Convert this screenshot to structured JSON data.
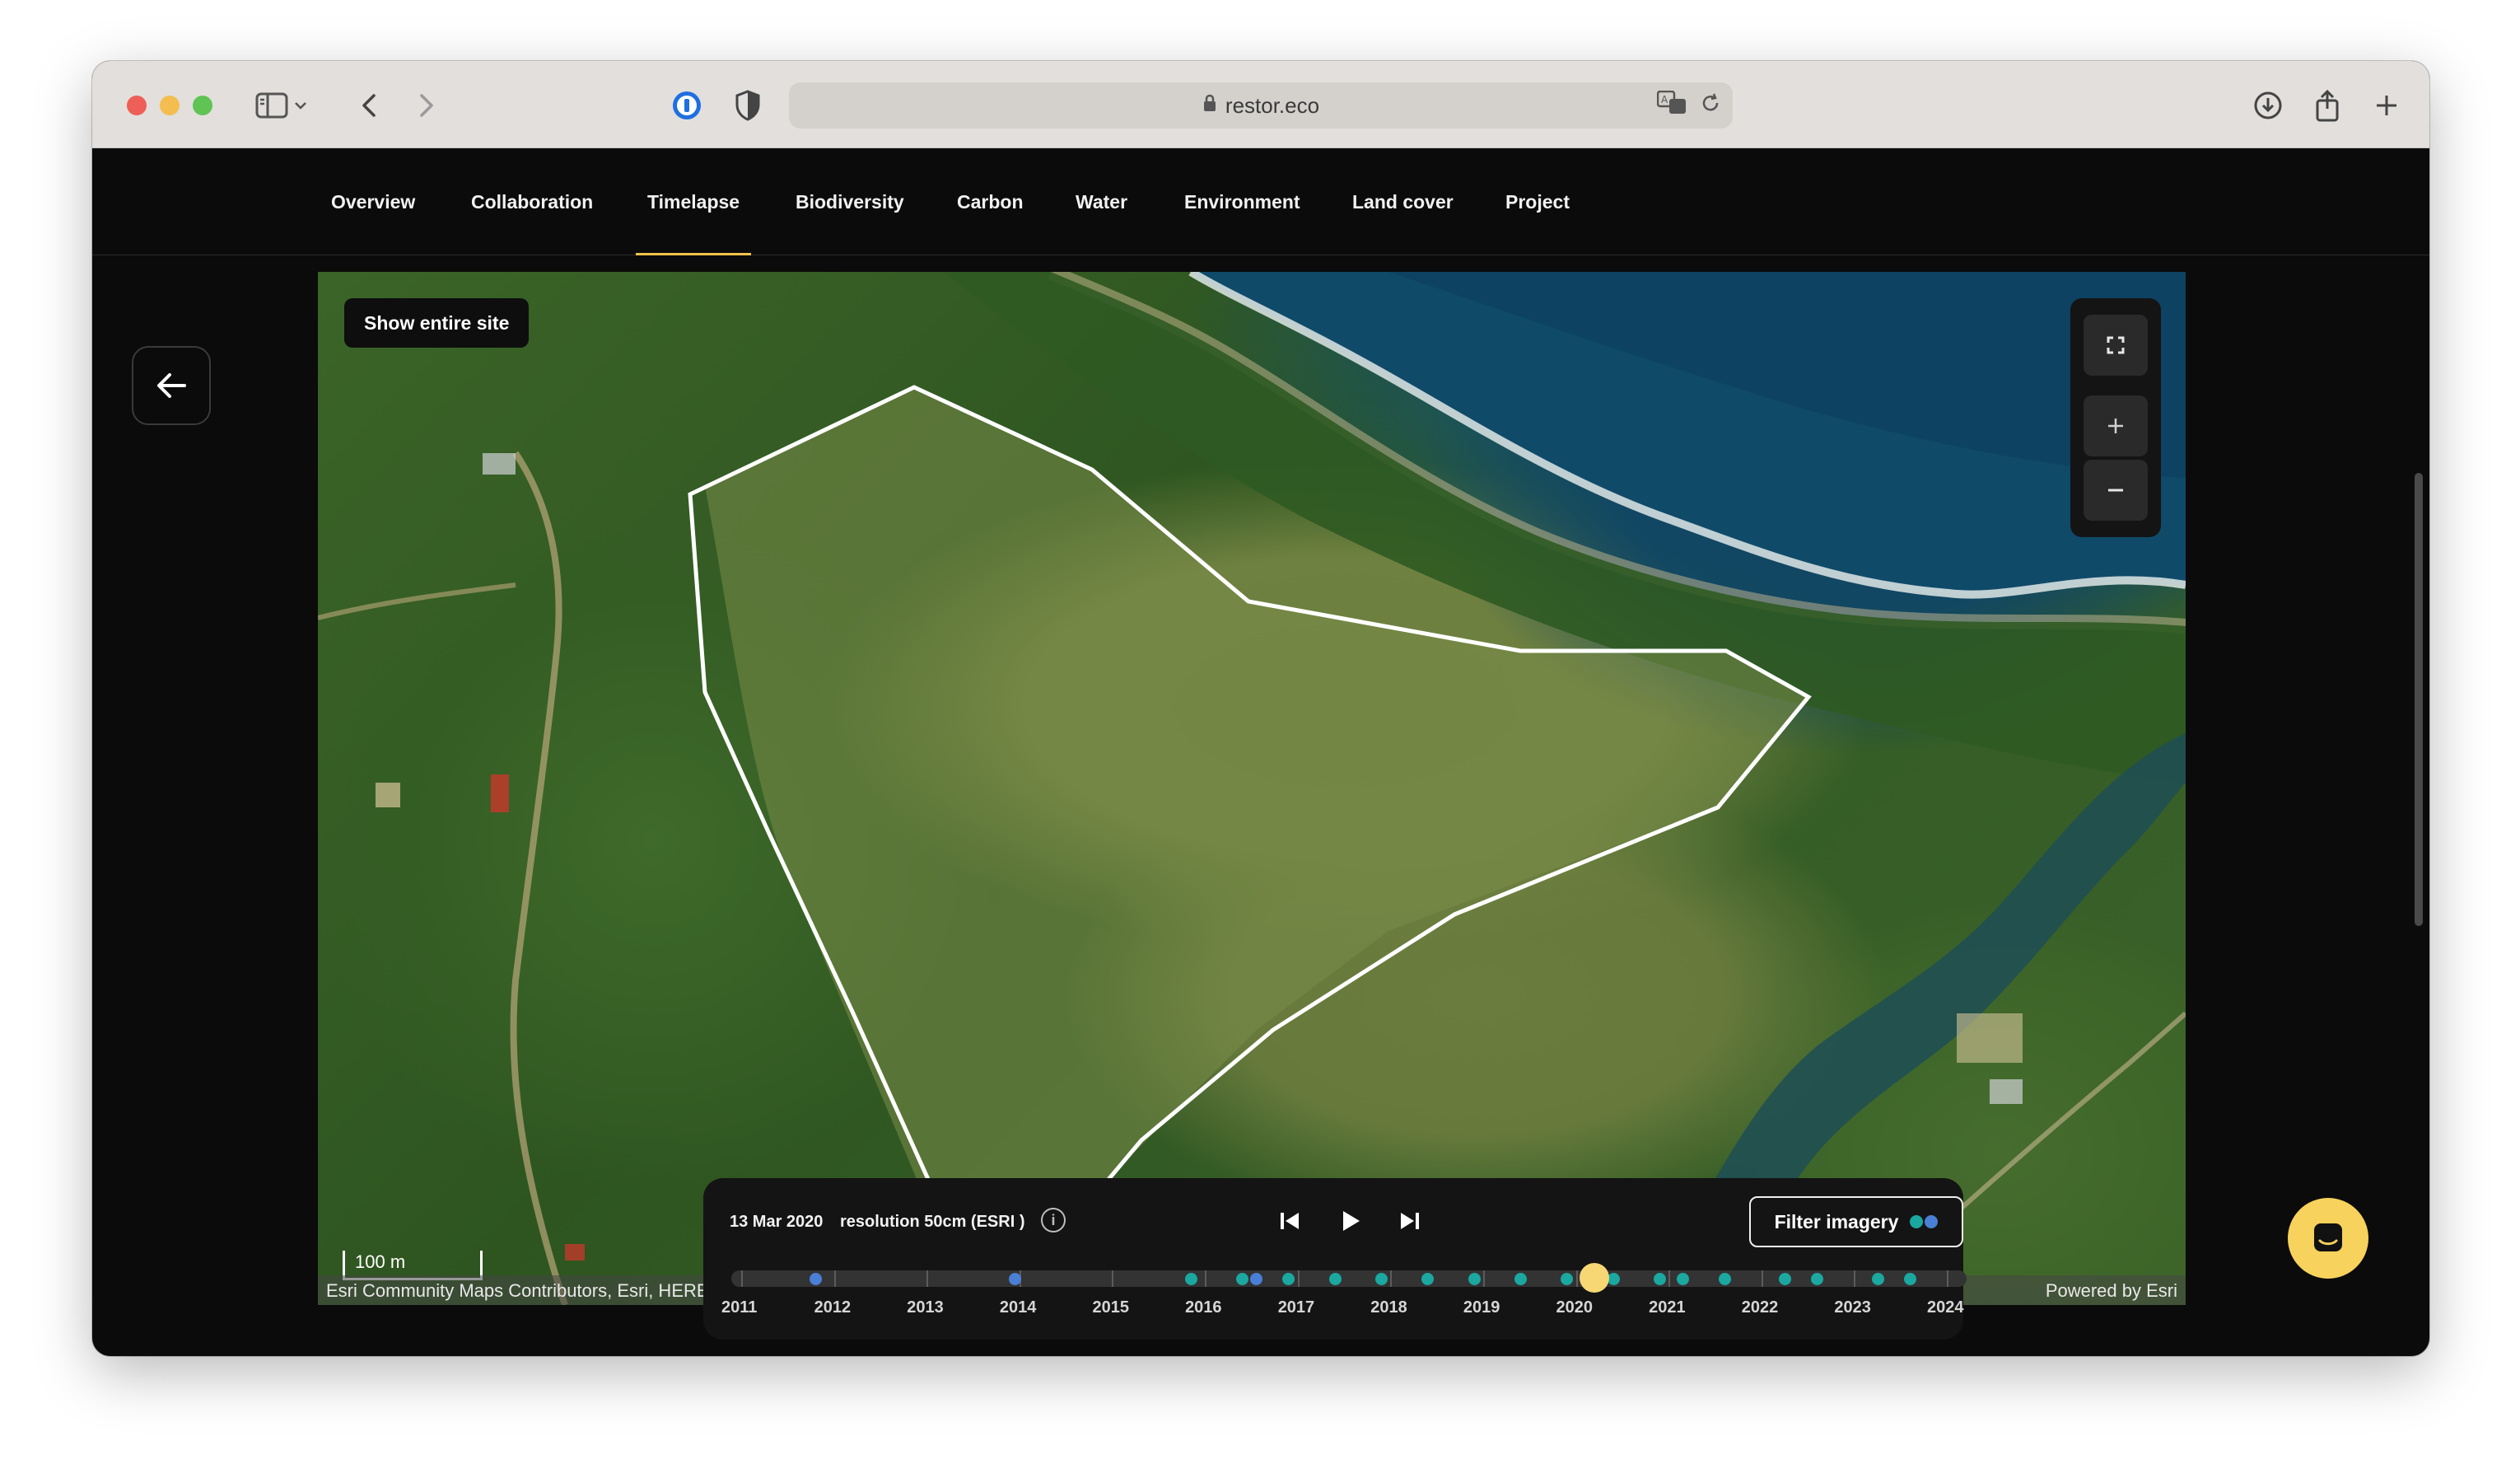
{
  "browser": {
    "url": "restor.eco"
  },
  "nav": {
    "items": [
      {
        "label": "Overview"
      },
      {
        "label": "Collaboration"
      },
      {
        "label": "Timelapse"
      },
      {
        "label": "Biodiversity"
      },
      {
        "label": "Carbon"
      },
      {
        "label": "Water"
      },
      {
        "label": "Environment"
      },
      {
        "label": "Land cover"
      },
      {
        "label": "Project"
      }
    ],
    "active": "Timelapse"
  },
  "map": {
    "show_site_label": "Show entire site",
    "scale_label": "100 m",
    "attribution_left": "Esri Community Maps Contributors, Esri, HERE, Garmin, Foursquare, METI/NASA, USGS",
    "attribution_right": "Powered by Esri"
  },
  "timeline": {
    "date": "13 Mar 2020",
    "resolution": "resolution 50cm (ESRI )",
    "filter_label": "Filter imagery",
    "years": [
      "2011",
      "2012",
      "2013",
      "2014",
      "2015",
      "2016",
      "2017",
      "2018",
      "2019",
      "2020",
      "2021",
      "2022",
      "2023",
      "2024"
    ],
    "selected_year": 2020.2,
    "imagery_dates": [
      {
        "t": 2011.8,
        "source": "blue"
      },
      {
        "t": 2013.95,
        "source": "blue"
      },
      {
        "t": 2015.85,
        "source": "teal"
      },
      {
        "t": 2016.4,
        "source": "teal"
      },
      {
        "t": 2016.55,
        "source": "blue"
      },
      {
        "t": 2016.9,
        "source": "teal"
      },
      {
        "t": 2017.4,
        "source": "teal"
      },
      {
        "t": 2017.9,
        "source": "teal"
      },
      {
        "t": 2018.4,
        "source": "teal"
      },
      {
        "t": 2018.9,
        "source": "teal"
      },
      {
        "t": 2019.4,
        "source": "teal"
      },
      {
        "t": 2019.9,
        "source": "teal"
      },
      {
        "t": 2020.4,
        "source": "teal"
      },
      {
        "t": 2020.9,
        "source": "teal"
      },
      {
        "t": 2021.15,
        "source": "teal"
      },
      {
        "t": 2021.6,
        "source": "teal"
      },
      {
        "t": 2022.25,
        "source": "teal"
      },
      {
        "t": 2022.6,
        "source": "teal"
      },
      {
        "t": 2023.25,
        "source": "teal"
      },
      {
        "t": 2023.6,
        "source": "teal"
      }
    ],
    "colors": {
      "blue": "#4a7fd6",
      "teal": "#1aa8a0",
      "cursor": "#f7d774"
    }
  },
  "colors": {
    "accent": "#f0c24b",
    "help_bubble": "#f7d25c"
  }
}
